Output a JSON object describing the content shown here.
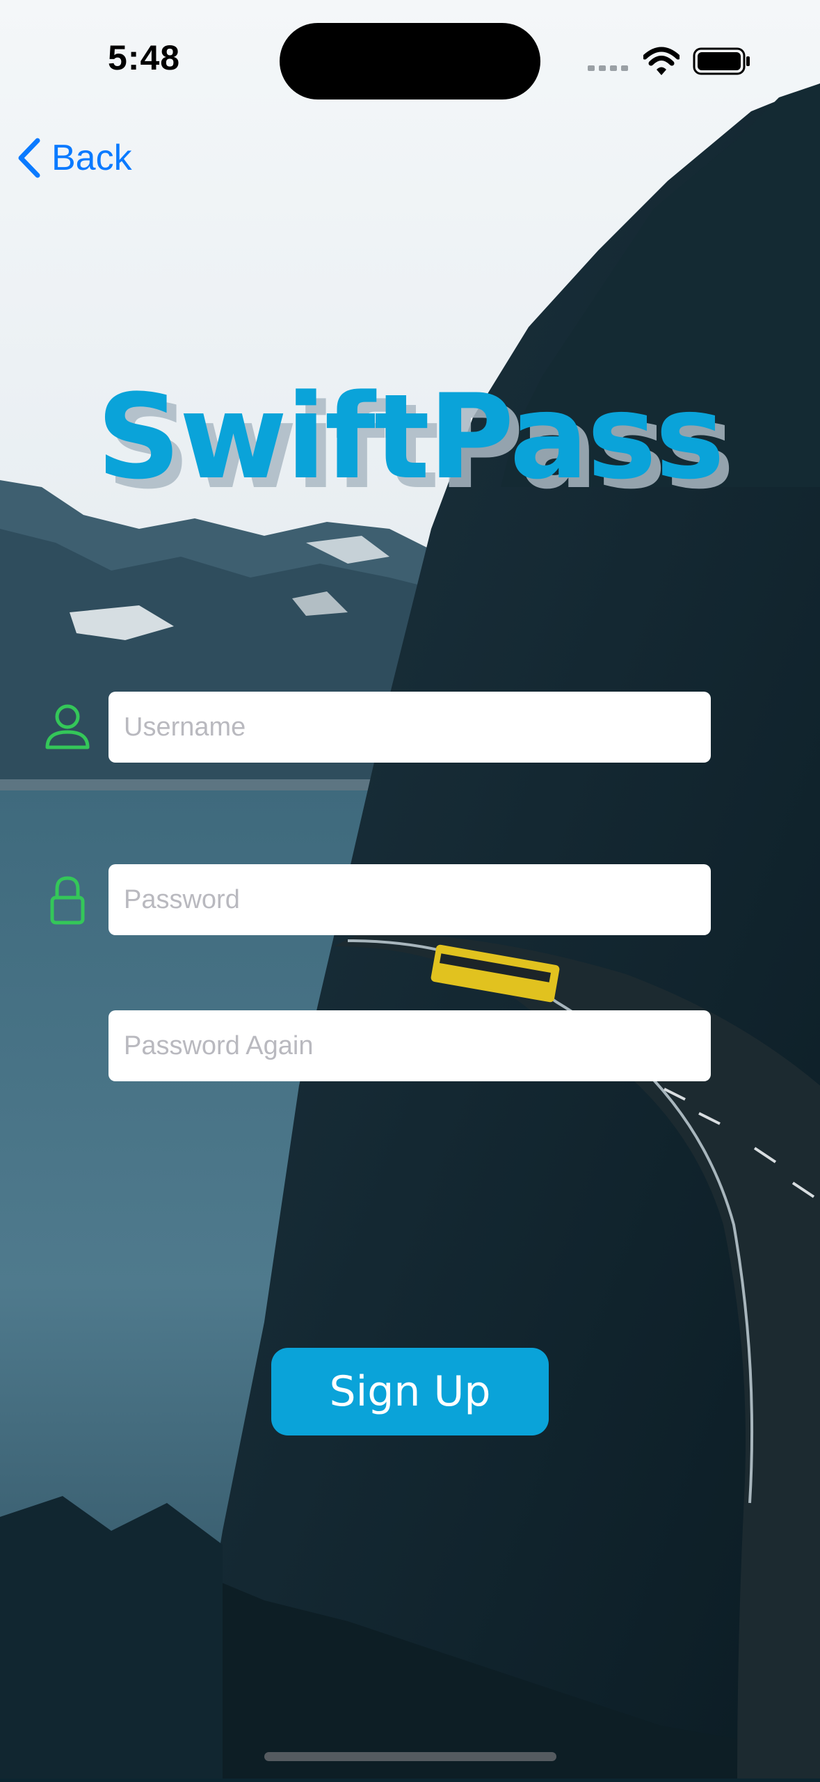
{
  "status_bar": {
    "time": "5:48",
    "icons": [
      "cellular-signal-icon",
      "wifi-icon",
      "battery-icon"
    ]
  },
  "nav": {
    "back_label": "Back",
    "back_icon": "chevron-left-icon"
  },
  "logo": {
    "text": "SwiftPass"
  },
  "form": {
    "username": {
      "value": "",
      "placeholder": "Username",
      "icon": "person-icon"
    },
    "password": {
      "value": "",
      "placeholder": "Password",
      "icon": "lock-icon"
    },
    "password_again": {
      "value": "",
      "placeholder": "Password Again"
    }
  },
  "actions": {
    "signup_label": "Sign Up"
  },
  "colors": {
    "accent": "#0aa3d9",
    "link": "#0a7aff",
    "icon_green": "#34c759"
  }
}
